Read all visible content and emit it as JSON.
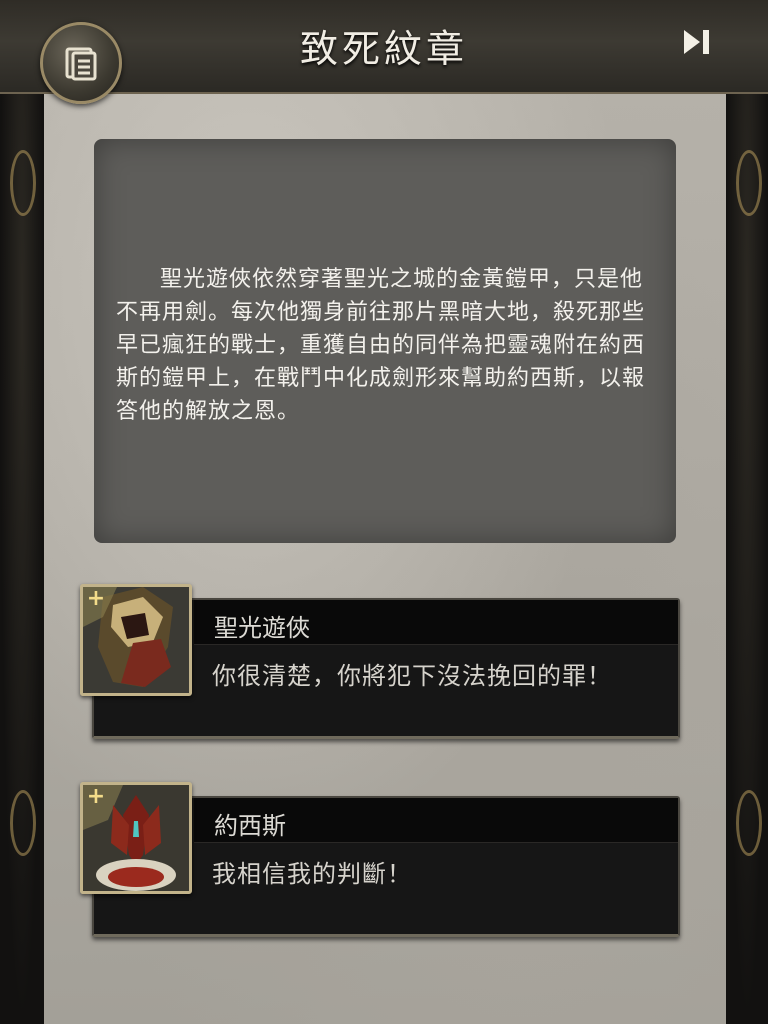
{
  "header": {
    "title": "致死紋章",
    "menu_icon": "scroll-menu-icon",
    "skip_icon": "skip-forward-icon"
  },
  "story": {
    "text": "聖光遊俠依然穿著聖光之城的金黃鎧甲，只是他不再用劍。每次他獨身前往那片黑暗大地，殺死那些早已瘋狂的戰士，重獲自由的同伴為把靈魂附在約西斯的鎧甲上，在戰鬥中化成劍形來幫助約西斯，以報答他的解放之恩。"
  },
  "dialogues": [
    {
      "speaker": "聖光遊俠",
      "line": "你很清楚，你將犯下沒法挽回的罪！",
      "portrait_icon": "holy-ranger-portrait"
    },
    {
      "speaker": "約西斯",
      "line": "我相信我的判斷！",
      "portrait_icon": "josis-portrait"
    }
  ],
  "colors": {
    "title": "#f1ede4",
    "parchment": "#b5b1a9",
    "story_box": "#5e5d5a",
    "dialog_bg": "#161616",
    "gold_border": "#c2b38a"
  }
}
